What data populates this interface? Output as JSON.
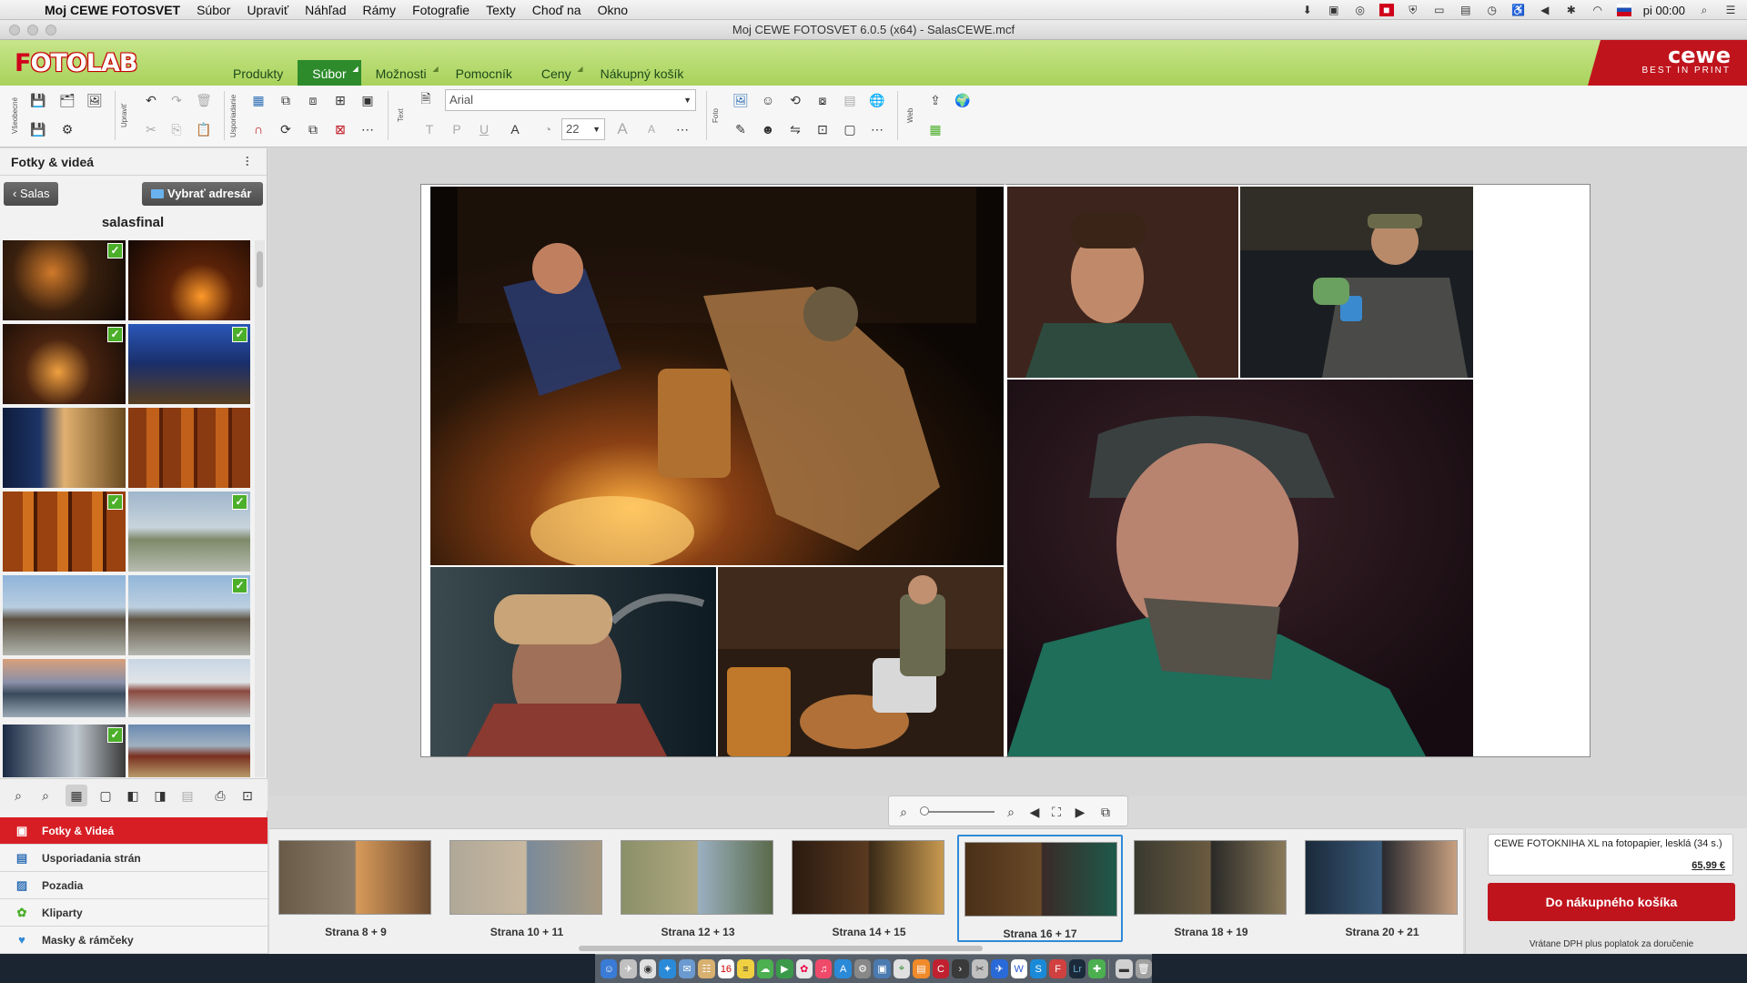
{
  "mac_menu": {
    "app_name": "Moj CEWE FOTOSVET",
    "items": [
      "Súbor",
      "Upraviť",
      "Náhľad",
      "Rámy",
      "Fotografie",
      "Texty",
      "Choď na",
      "Okno"
    ],
    "clock": "pi 00:00"
  },
  "window": {
    "title": "Moj CEWE FOTOSVET 6.0.5 (x64) - SalasCEWE.mcf"
  },
  "brand": {
    "logo_f": "F",
    "logo_rest": "OTOLAB",
    "cewe_name": "cewe",
    "cewe_tagline": "BEST IN PRINT",
    "accent": "#2d8b2b",
    "brand_red": "#c0141d"
  },
  "nav": {
    "tabs": [
      {
        "label": "Produkty"
      },
      {
        "label": "Súbor"
      },
      {
        "label": "Možnosti"
      },
      {
        "label": "Pomocník"
      },
      {
        "label": "Ceny"
      },
      {
        "label": "Nákupný košík"
      }
    ],
    "active": "Súbor"
  },
  "toolbar": {
    "group_labels": {
      "general": "Všeobecné",
      "edit": "Upraviť",
      "arrange": "Usporiadanie",
      "text": "Text",
      "photo": "Foto",
      "web": "Web"
    },
    "font_name": "Arial",
    "font_size": "22",
    "text_buttons": [
      "T",
      "P",
      "U"
    ],
    "grow_label": "A",
    "shrink_label": "A"
  },
  "left_panel": {
    "title": "Fotky & videá",
    "back_button": "Salas",
    "choose_folder_button": "Vybrať adresár",
    "folder_name": "salasfinal",
    "sections": [
      {
        "label": "Fotky & Videá",
        "icon": "photos-icon"
      },
      {
        "label": "Usporiadania strán",
        "icon": "page-layouts-icon"
      },
      {
        "label": "Pozadia",
        "icon": "backgrounds-icon"
      },
      {
        "label": "Kliparty",
        "icon": "cliparts-icon"
      },
      {
        "label": "Masky & rámčeky",
        "icon": "masks-frames-icon"
      }
    ],
    "active_section": "Fotky & Videá"
  },
  "pages": {
    "items": [
      {
        "label": "Strana 8 + 9"
      },
      {
        "label": "Strana 10 + 11"
      },
      {
        "label": "Strana 12 + 13"
      },
      {
        "label": "Strana 14 + 15"
      },
      {
        "label": "Strana 16 + 17"
      },
      {
        "label": "Strana 18 + 19"
      },
      {
        "label": "Strana 20 + 21"
      }
    ],
    "active": "Strana 16 + 17"
  },
  "cart": {
    "product_name": "CEWE FOTOKNIHA XL na fotopapier, lesklá (34 s.)",
    "price": "65,99 €",
    "button_label": "Do nákupného košíka",
    "vat_note": "Vrátane DPH plus poplatok za doručenie"
  }
}
